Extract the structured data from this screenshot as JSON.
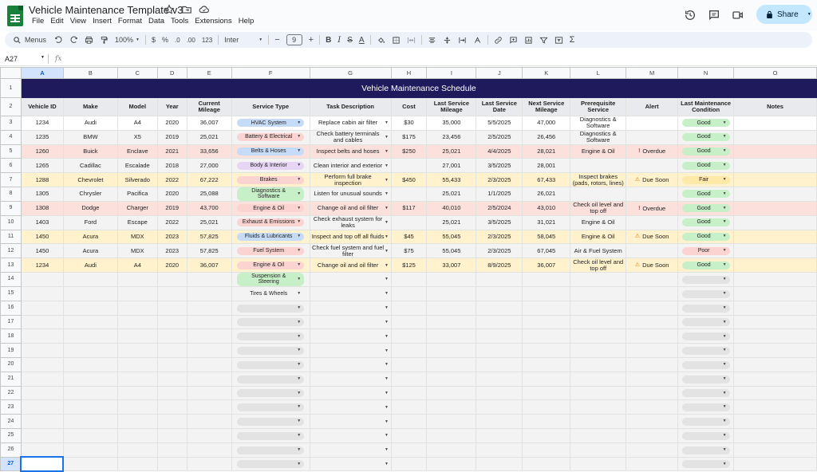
{
  "window": {
    "title": "Vehicle Maintenance Template v3",
    "menu": [
      "File",
      "Edit",
      "View",
      "Insert",
      "Format",
      "Data",
      "Tools",
      "Extensions",
      "Help"
    ],
    "share_label": "Share"
  },
  "toolbar": {
    "menus_label": "Menus",
    "zoom": "100%",
    "currency": "$",
    "percent": "%",
    "decimal_dec": ".0",
    "decimal_inc": ".00",
    "number_format": "123",
    "font": "Inter",
    "font_size": "9"
  },
  "formula_bar": {
    "cell_ref": "A27",
    "fx": "fx",
    "value": ""
  },
  "columns": [
    "A",
    "B",
    "C",
    "D",
    "E",
    "F",
    "G",
    "H",
    "I",
    "J",
    "K",
    "L",
    "M",
    "N",
    "O"
  ],
  "sheet_title": "Vehicle Maintenance Schedule",
  "headers": [
    "Vehicle ID",
    "Make",
    "Model",
    "Year",
    "Current Mileage",
    "Service Type",
    "Task Description",
    "Cost",
    "Last Service Mileage",
    "Last Service Date",
    "Next Service Mileage",
    "Prerequisite Service",
    "Alert",
    "Last Maintenance Condition",
    "Notes"
  ],
  "rows": [
    {
      "row": "3",
      "tone": "r-wht",
      "id": "1234",
      "make": "Audi",
      "model": "A4",
      "year": "2020",
      "cur": "36,007",
      "svc": "HVAC System",
      "svc_color": "#c6dbf7",
      "task": "Replace cabin air filter",
      "cost": "$30",
      "lsm": "35,000",
      "lsd": "5/5/2025",
      "nsm": "47,000",
      "pre": "Diagnostics & Software",
      "alert": "",
      "alert_type": "",
      "cond": "Good",
      "cond_color": "#c8f0c8"
    },
    {
      "row": "4",
      "tone": "r-gry",
      "id": "1235",
      "make": "BMW",
      "model": "X5",
      "year": "2019",
      "cur": "25,021",
      "svc": "Battery & Electrical",
      "svc_color": "#fbd3d0",
      "task": "Check battery terminals and cables",
      "cost": "$175",
      "lsm": "23,456",
      "lsd": "2/5/2025",
      "nsm": "26,456",
      "pre": "Diagnostics & Software",
      "alert": "",
      "alert_type": "",
      "cond": "Good",
      "cond_color": "#c8f0c8"
    },
    {
      "row": "5",
      "tone": "r-red",
      "id": "1260",
      "make": "Buick",
      "model": "Enclave",
      "year": "2021",
      "cur": "33,656",
      "svc": "Belts & Hoses",
      "svc_color": "#c6dbf7",
      "task": "Inspect belts and hoses",
      "cost": "$250",
      "lsm": "25,021",
      "lsd": "4/4/2025",
      "nsm": "28,021",
      "pre": "Engine & Oil",
      "alert": "Overdue",
      "alert_type": "red",
      "cond": "Good",
      "cond_color": "#c8f0c8"
    },
    {
      "row": "6",
      "tone": "r-gry",
      "id": "1265",
      "make": "Cadillac",
      "model": "Escalade",
      "year": "2018",
      "cur": "27,000",
      "svc": "Body & Interior",
      "svc_color": "#e6d5f5",
      "task": "Clean interior and exterior",
      "cost": "",
      "lsm": "27,001",
      "lsd": "3/5/2025",
      "nsm": "28,001",
      "pre": "",
      "alert": "",
      "alert_type": "",
      "cond": "Good",
      "cond_color": "#c8f0c8"
    },
    {
      "row": "7",
      "tone": "r-yel",
      "id": "1288",
      "make": "Chevrolet",
      "model": "Silverado",
      "year": "2022",
      "cur": "67,222",
      "svc": "Brakes",
      "svc_color": "#fbd3d0",
      "task": "Perform full brake inspection",
      "cost": "$450",
      "lsm": "55,433",
      "lsd": "2/3/2025",
      "nsm": "67,433",
      "pre": "Inspect brakes (pads, rotors, lines)",
      "alert": "Due Soon",
      "alert_type": "yel",
      "cond": "Fair",
      "cond_color": "#ffe9a8"
    },
    {
      "row": "8",
      "tone": "r-gry",
      "id": "1305",
      "make": "Chrysler",
      "model": "Pacifica",
      "year": "2020",
      "cur": "25,088",
      "svc": "Diagnostics & Software",
      "svc_color": "#c8f0c8",
      "task": "Listen for unusual sounds",
      "cost": "",
      "lsm": "25,021",
      "lsd": "1/1/2025",
      "nsm": "26,021",
      "pre": "",
      "alert": "",
      "alert_type": "",
      "cond": "Good",
      "cond_color": "#c8f0c8"
    },
    {
      "row": "9",
      "tone": "r-red",
      "id": "1308",
      "make": "Dodge",
      "model": "Charger",
      "year": "2019",
      "cur": "43,700",
      "svc": "Engine & Oil",
      "svc_color": "#fbd3d0",
      "task": "Change oil and oil filter",
      "cost": "$117",
      "lsm": "40,010",
      "lsd": "2/5/2024",
      "nsm": "43,010",
      "pre": "Check oil level and top off",
      "alert": "Overdue",
      "alert_type": "red",
      "cond": "Good",
      "cond_color": "#c8f0c8"
    },
    {
      "row": "10",
      "tone": "r-gry",
      "id": "1403",
      "make": "Ford",
      "model": "Escape",
      "year": "2022",
      "cur": "25,021",
      "svc": "Exhaust & Emissions",
      "svc_color": "#fbd3d0",
      "task": "Check exhaust system for leaks",
      "cost": "",
      "lsm": "25,021",
      "lsd": "3/5/2025",
      "nsm": "31,021",
      "pre": "Engine & Oil",
      "alert": "",
      "alert_type": "",
      "cond": "Good",
      "cond_color": "#c8f0c8"
    },
    {
      "row": "11",
      "tone": "r-yel",
      "id": "1450",
      "make": "Acura",
      "model": "MDX",
      "year": "2023",
      "cur": "57,825",
      "svc": "Fluids & Lubricants",
      "svc_color": "#c6dbf7",
      "task": "Inspect and top off all fluids",
      "cost": "$45",
      "lsm": "55,045",
      "lsd": "2/3/2025",
      "nsm": "58,045",
      "pre": "Engine & Oil",
      "alert": "Due Soon",
      "alert_type": "yel",
      "cond": "Good",
      "cond_color": "#c8f0c8"
    },
    {
      "row": "12",
      "tone": "r-gry",
      "id": "1450",
      "make": "Acura",
      "model": "MDX",
      "year": "2023",
      "cur": "57,825",
      "svc": "Fuel System",
      "svc_color": "#fbd3d0",
      "task": "Check fuel system and fuel filter",
      "cost": "$75",
      "lsm": "55,045",
      "lsd": "2/3/2025",
      "nsm": "67,045",
      "pre": "Air & Fuel System",
      "alert": "",
      "alert_type": "",
      "cond": "Poor",
      "cond_color": "#fbd3d0"
    },
    {
      "row": "13",
      "tone": "r-yel",
      "id": "1234",
      "make": "Audi",
      "model": "A4",
      "year": "2020",
      "cur": "36,007",
      "svc": "Engine & Oil",
      "svc_color": "#fbd3d0",
      "task": "Change oil and oil filter",
      "cost": "$125",
      "lsm": "33,007",
      "lsd": "8/9/2025",
      "nsm": "36,007",
      "pre": "Check oil level and top off",
      "alert": "Due Soon",
      "alert_type": "yel",
      "cond": "Good",
      "cond_color": "#c8f0c8"
    }
  ],
  "empty_rows": [
    {
      "row": "14",
      "svc": "Suspension & Steering",
      "svc_color": "#c8f0c8"
    },
    {
      "row": "15",
      "svc": "Tires & Wheels",
      "svc_color": "plain"
    },
    {
      "row": "16",
      "svc": "",
      "svc_color": "empty"
    },
    {
      "row": "17",
      "svc": "",
      "svc_color": "empty"
    },
    {
      "row": "18",
      "svc": "",
      "svc_color": "empty"
    },
    {
      "row": "19",
      "svc": "",
      "svc_color": "empty"
    },
    {
      "row": "20",
      "svc": "",
      "svc_color": "empty"
    },
    {
      "row": "21",
      "svc": "",
      "svc_color": "empty"
    },
    {
      "row": "22",
      "svc": "",
      "svc_color": "empty"
    },
    {
      "row": "23",
      "svc": "",
      "svc_color": "empty"
    },
    {
      "row": "24",
      "svc": "",
      "svc_color": "empty"
    },
    {
      "row": "25",
      "svc": "",
      "svc_color": "empty"
    },
    {
      "row": "26",
      "svc": "",
      "svc_color": "empty"
    },
    {
      "row": "27",
      "svc": "",
      "svc_color": "empty"
    }
  ],
  "selected_cell": {
    "row": "27",
    "col": "A"
  },
  "colors": {
    "banner": "#1f1a5c",
    "accent": "#0b57d0",
    "share_bg": "#c2e7ff"
  },
  "icons": {
    "star": "star-icon",
    "folder": "move-folder-icon",
    "cloud": "cloud-saved-icon",
    "history": "version-history-icon",
    "comment": "comment-icon",
    "meet": "video-call-icon",
    "lock": "lock-icon"
  }
}
